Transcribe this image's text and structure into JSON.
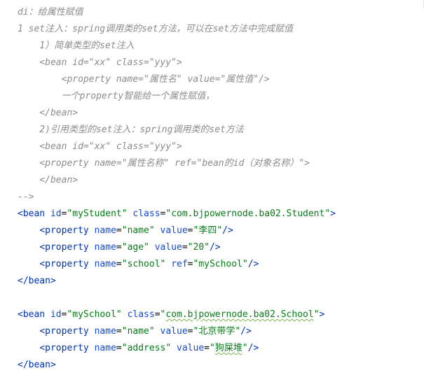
{
  "comment_lines": [
    "di：给属性赋值",
    "1 set注入：spring调用类的set方法，可以在set方法中完成赋值",
    "    1）简单类型的set注入",
    "    <bean id=\"xx\" class=\"yyy\">",
    "        <property name=\"属性名\" value=\"属性值\"/>",
    "        一个property智能给一个属性赋值，",
    "    </bean>",
    "    2)引用类型的set注入：spring调用类的set方法",
    "    <bean id=\"xx\" class=\"yyy\">",
    "    <property name=\"属性名称\" ref=\"bean的id（对象名称）\">",
    "    </bean>",
    "-->"
  ],
  "bean_student": {
    "tag": "bean",
    "id": "myStudent",
    "class": "com.bjpowernode.ba02.Student",
    "properties": [
      {
        "name": "name",
        "attr": "value",
        "val": "李四"
      },
      {
        "name": "age",
        "attr": "value",
        "val": "20"
      },
      {
        "name": "school",
        "attr": "ref",
        "val": "mySchool"
      }
    ]
  },
  "bean_school": {
    "tag": "bean",
    "id": "mySchool",
    "class": "com.bjpowernode.ba02.School",
    "properties": [
      {
        "name": "name",
        "attr": "value",
        "val": "北京带学"
      },
      {
        "name": "address",
        "attr": "value",
        "val": "狗屎堆"
      }
    ]
  },
  "syntax": {
    "id_attr": "id",
    "class_attr": "class",
    "name_attr": "name",
    "property_tag": "property",
    "close_bean": "</bean>"
  },
  "colors": {
    "comment": "#8c8c8c",
    "tag": "#0033b3",
    "attribute": "#174ad4",
    "string": "#067d17",
    "background": "#ffffff"
  }
}
